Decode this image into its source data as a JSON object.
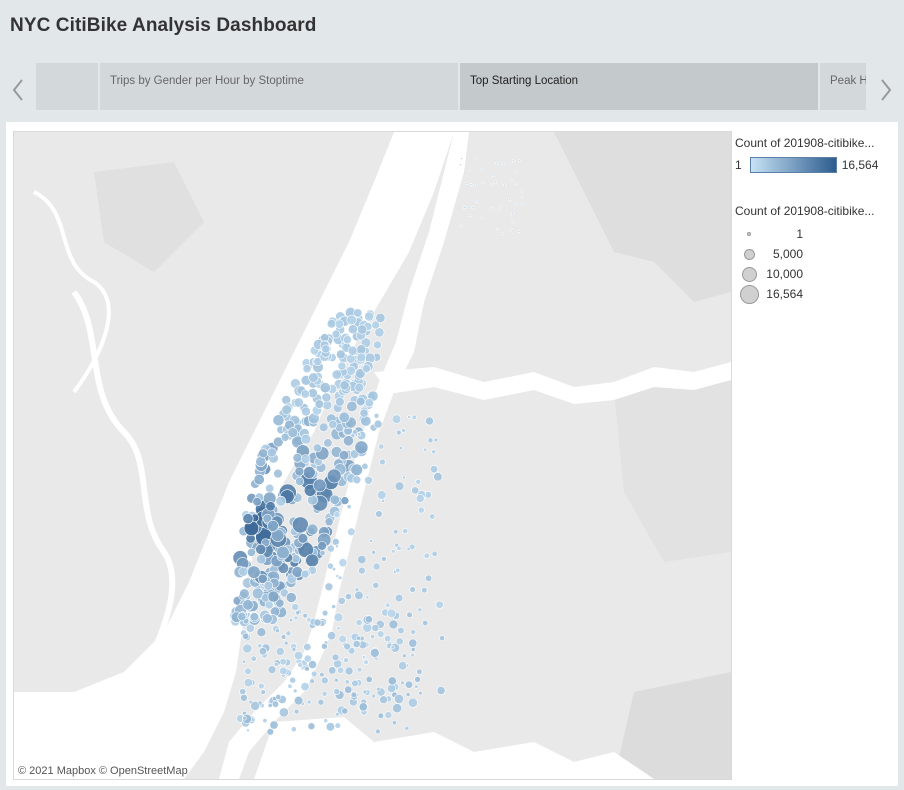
{
  "title": "NYC CitiBike Analysis Dashboard",
  "story_nav": {
    "prev_icon": "chevron-left-icon",
    "next_icon": "chevron-right-icon",
    "tabs": [
      {
        "label": ""
      },
      {
        "label": "Trips by Gender  per Hour by Stoptime"
      },
      {
        "label": "Top Starting Location",
        "selected": true
      },
      {
        "label": "Peak Hours"
      }
    ]
  },
  "map": {
    "attribution": "© 2021 Mapbox  © OpenStreetMap"
  },
  "color_legend": {
    "title": "Count of 201908-citibike...",
    "min": "1",
    "max": "16,564",
    "colors": {
      "low": "#c6e2f5",
      "high": "#2d5c8e"
    }
  },
  "size_legend": {
    "title": "Count of 201908-citibike...",
    "items": [
      {
        "label": "1",
        "value": 1
      },
      {
        "label": "5,000",
        "value": 5000
      },
      {
        "label": "10,000",
        "value": 10000
      },
      {
        "label": "16,564",
        "value": 16564
      }
    ]
  }
}
